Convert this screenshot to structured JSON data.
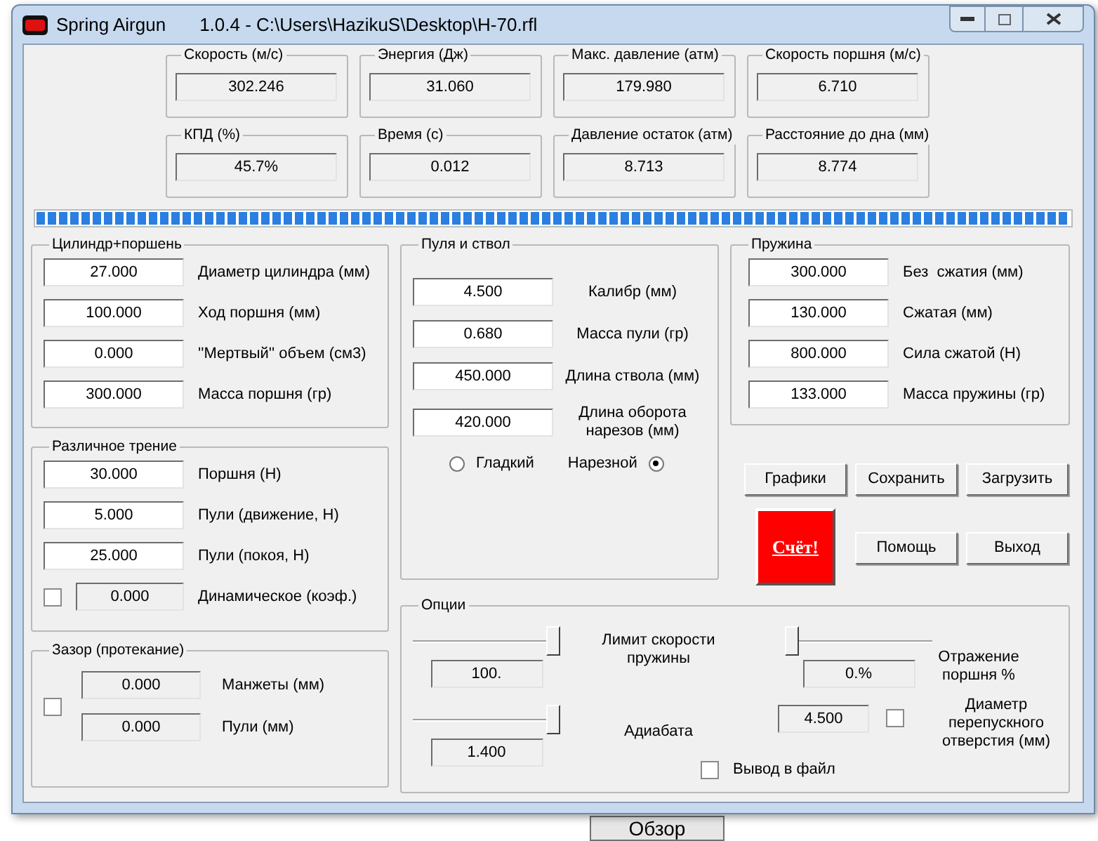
{
  "window": {
    "title": "Spring Airgun",
    "subtitle": "1.0.4 - C:\\Users\\HazikuS\\Desktop\\H-70.rfl"
  },
  "results": [
    {
      "label": "Скорость (м/с)",
      "value": "302.246"
    },
    {
      "label": "Энергия (Дж)",
      "value": "31.060"
    },
    {
      "label": "Макс. давление (атм)",
      "value": "179.980"
    },
    {
      "label": "Скорость поршня (м/с)",
      "value": "6.710"
    },
    {
      "label": "КПД (%)",
      "value": "45.7%"
    },
    {
      "label": "Время (с)",
      "value": "0.012"
    },
    {
      "label": "Давление остаток (атм)",
      "value": "8.713"
    },
    {
      "label": "Расстояние до дна (мм)",
      "value": "8.774"
    }
  ],
  "progress": {
    "level": 1
  },
  "cylinder": {
    "title": "Цилиндр+поршень",
    "fields": [
      {
        "value": "27.000",
        "label": "Диаметр цилиндра (мм)"
      },
      {
        "value": "100.000",
        "label": "Ход поршня (мм)"
      },
      {
        "value": "0.000",
        "label": "''Мертвый'' объем (см3)"
      },
      {
        "value": "300.000",
        "label": "Масса поршня (гр)"
      }
    ]
  },
  "friction": {
    "title": "Различное трение",
    "fields": [
      {
        "value": "30.000",
        "label": "Поршня (Н)"
      },
      {
        "value": "5.000",
        "label": "Пули (движение, Н)"
      },
      {
        "value": "25.000",
        "label": "Пули (покоя, Н)"
      }
    ],
    "dynamic": {
      "checked": false,
      "value": "0.000",
      "label": "Динамическое (коэф.)"
    }
  },
  "gap": {
    "title": "Зазор (протекание)",
    "checked": false,
    "fields": [
      {
        "value": "0.000",
        "label": "Манжеты (мм)"
      },
      {
        "value": "0.000",
        "label": "Пули (мм)"
      }
    ]
  },
  "bullet": {
    "title": "Пуля и ствол",
    "fields": [
      {
        "value": "4.500",
        "label": "Калибр (мм)"
      },
      {
        "value": "0.680",
        "label": "Масса пули (гр)"
      },
      {
        "value": "450.000",
        "label": "Длина ствола (мм)"
      },
      {
        "value": "420.000",
        "label": "Длина оборота нарезов (мм)"
      }
    ],
    "radios": [
      {
        "label": "Гладкий",
        "selected": false
      },
      {
        "label": "Нарезной",
        "selected": true
      }
    ]
  },
  "spring": {
    "title": "Пружина",
    "fields": [
      {
        "value": "300.000",
        "label": "Без  сжатия (мм)"
      },
      {
        "value": "130.000",
        "label": "Сжатая (мм)"
      },
      {
        "value": "800.000",
        "label": "Сила сжатой (Н)"
      },
      {
        "value": "133.000",
        "label": "Масса пружины (гр)"
      }
    ]
  },
  "buttons": [
    [
      {
        "label": "Графики",
        "kind": "normal"
      },
      {
        "label": "Сохранить",
        "kind": "normal"
      },
      {
        "label": "Загрузить",
        "kind": "normal"
      }
    ],
    [
      {
        "label": "Счёт!",
        "kind": "calc"
      },
      {
        "label": "Помощь",
        "kind": "normal"
      },
      {
        "label": "Выход",
        "kind": "normal"
      }
    ]
  ],
  "options": {
    "title": "Опции",
    "sliders": [
      {
        "label": "Лимит скорости пружины",
        "value": "100.",
        "level": 1
      },
      {
        "label": "Адиабата",
        "value": "1.400",
        "level": 1
      },
      {
        "label": "Отражение поршня %",
        "value": "0.%",
        "level": 0
      }
    ],
    "bypass": {
      "value": "4.500",
      "checked": false,
      "label": "Диаметр перепускного отверстия (мм)"
    },
    "file_output": {
      "checked": false,
      "label": "Вывод в файл"
    }
  },
  "background": {
    "button": "Обзор"
  }
}
